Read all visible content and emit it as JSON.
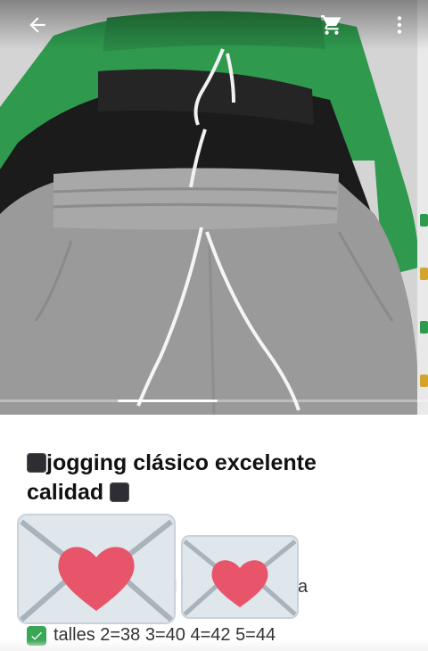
{
  "header": {
    "back_icon": "arrow-left-icon",
    "cart_icon": "cart-icon",
    "more_icon": "more-vert-icon"
  },
  "product": {
    "image_alt": "",
    "title": "⬛jogging clásico excelente calidad ⬛",
    "title_line1": "jogging clásico excelente",
    "title_line2": "calidad",
    "partial_letter_1": "l",
    "partial_letter_2": "a",
    "sizes": "talles 2=38 3=40 4=42 5=44"
  },
  "colors": {
    "green": "#2f9a4e",
    "black": "#1b1b1b",
    "gray": "#9a9a9a",
    "heart": "#e8556a",
    "envelope": "#dfe6ec",
    "check": "#3aa757"
  }
}
